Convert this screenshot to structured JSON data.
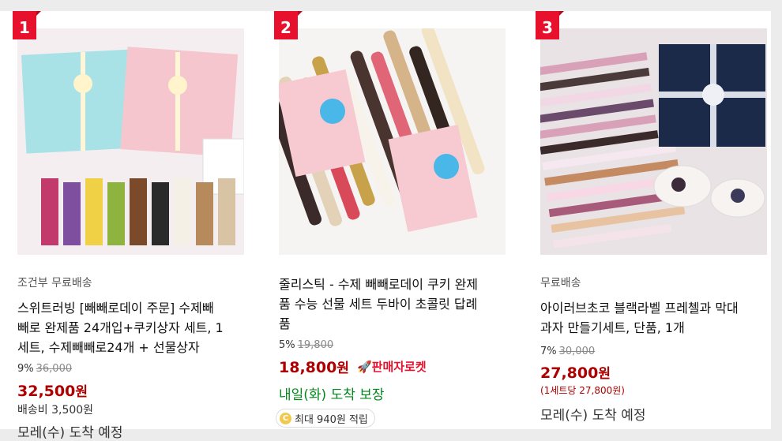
{
  "products": [
    {
      "rank": "1",
      "badge": "조건부 무료배송",
      "title_lines": [
        "스위트러빙 [빼빼로데이 주문] 수제빼",
        "빼로 완제품 24개입+쿠키상자 세트, 1",
        "세트, 수제빼빼로24개 + 선물상자"
      ],
      "discount_rate": "9%",
      "original_price": "36,000",
      "price": "32,500",
      "price_unit": "원",
      "shipping_fee": "배송비 3,500원",
      "delivery": "모레(수) 도착 예정",
      "image_icon": "gift-box-pepero-photo"
    },
    {
      "rank": "2",
      "title_lines": [
        "줄리스틱 - 수제 빼빼로데이 쿠키 완제",
        "품 수능 선물 세트 두바이 초콜릿 답례",
        "품"
      ],
      "discount_rate": "5%",
      "original_price": "19,800",
      "price": "18,800",
      "price_unit": "원",
      "rocket_label": "판매자로켓",
      "rocket_icon": "rocket-icon",
      "delivery": "내일(화) 도착 보장",
      "reward": "최대 940원 적립",
      "reward_icon": "coin-icon",
      "image_icon": "chocolate-sticks-photo"
    },
    {
      "rank": "3",
      "badge": "무료배송",
      "title_lines": [
        "아이러브초코 블랙라벨 프레첼과 막대",
        "과자 만들기세트, 단품, 1개"
      ],
      "discount_rate": "7%",
      "original_price": "30,000",
      "price": "27,800",
      "price_unit": "원",
      "unit_price": "(1세트당 27,800원)",
      "delivery": "모레(수) 도착 예정",
      "image_icon": "pretzel-gift-set-photo"
    }
  ],
  "colors": {
    "rank_badge": "#e8112d",
    "price": "#ae0000",
    "delivery_guaranteed": "#00891a",
    "rocket": "#e8112d"
  }
}
